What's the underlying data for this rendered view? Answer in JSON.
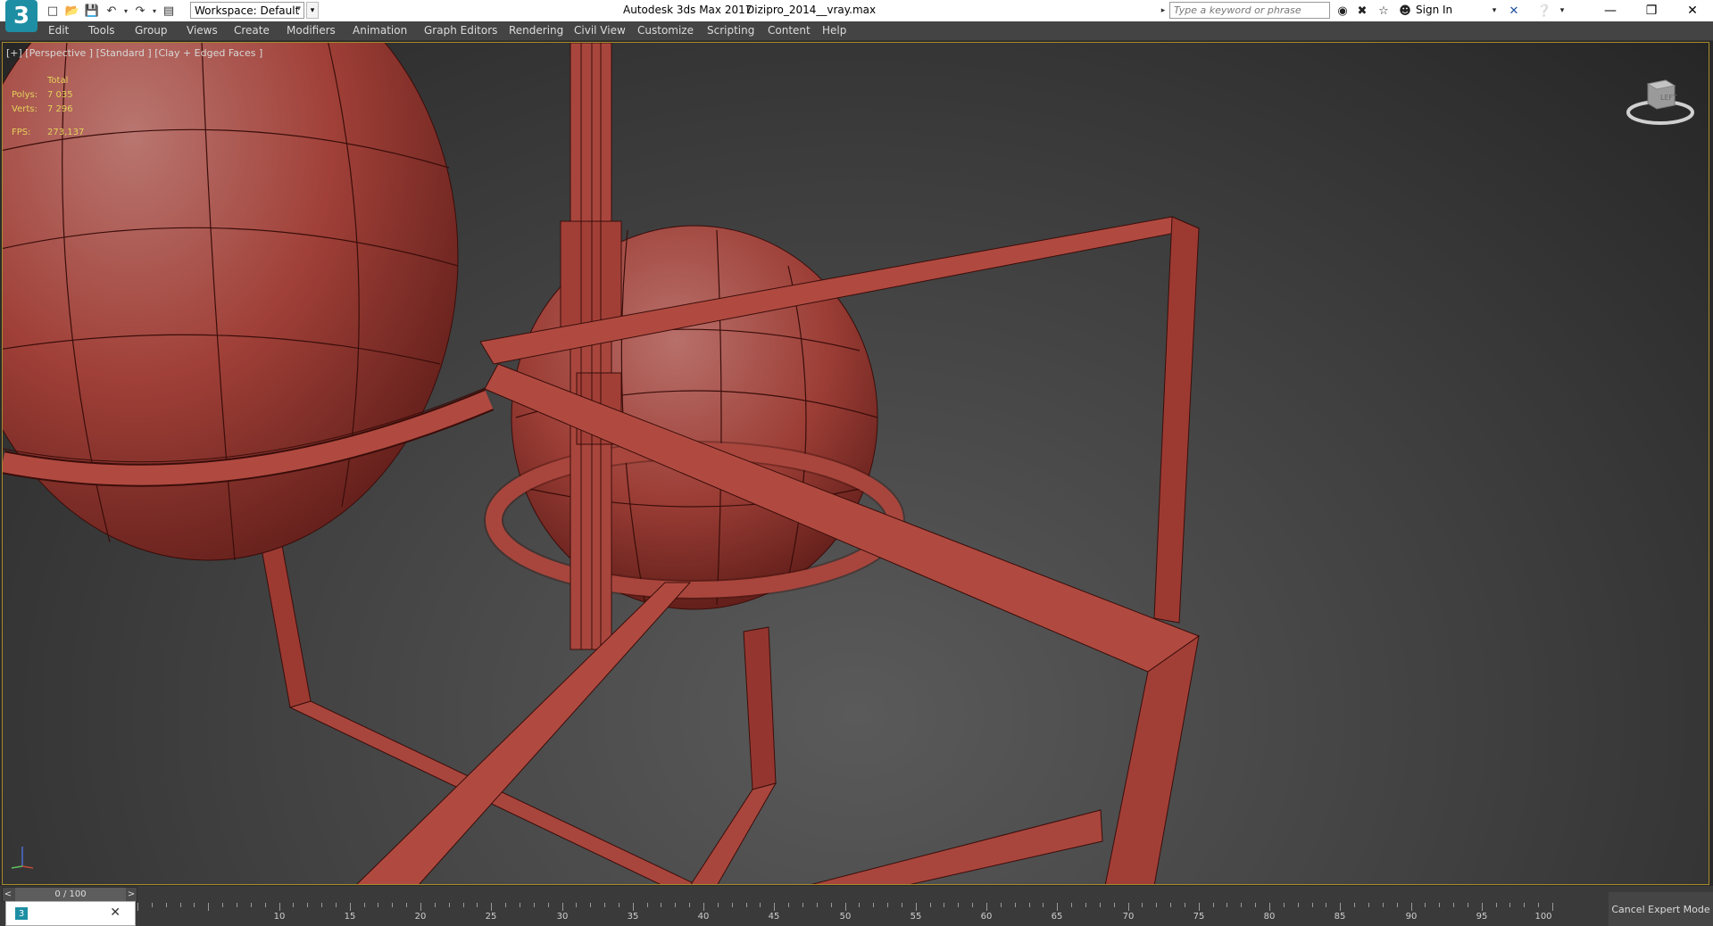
{
  "window": {
    "app_title": "Autodesk 3ds Max 2017",
    "document_name": "Dizipro_2014__vray.max",
    "logo_text": "3",
    "search_placeholder": "Type a keyword or phrase",
    "sign_in_label": "Sign In",
    "workspace_label": "Workspace: Default"
  },
  "menu": [
    "Edit",
    "Tools",
    "Group",
    "Views",
    "Create",
    "Modifiers",
    "Animation",
    "Graph Editors",
    "Rendering",
    "Civil View",
    "Customize",
    "Scripting",
    "Content",
    "Help"
  ],
  "viewport": {
    "label": "[+] [Perspective ] [Standard ] [Clay + Edged Faces ]",
    "stats": {
      "total_label": "Total",
      "polys_label": "Polys:",
      "polys_value": "7 035",
      "verts_label": "Verts:",
      "verts_value": "7 296",
      "fps_label": "FPS:",
      "fps_value": "273,137"
    },
    "viewcube_face": "LEFT",
    "model_color": "#b04a40",
    "selection_border": "#a68a2c"
  },
  "timeline": {
    "slider_text": "0 / 100",
    "tick_labels": [
      "10",
      "15",
      "20",
      "25",
      "30",
      "35",
      "40",
      "45",
      "50",
      "55",
      "60",
      "65",
      "70",
      "75",
      "80",
      "85",
      "90",
      "95",
      "100"
    ]
  },
  "status": {
    "cancel_expert_label": "Cancel Expert Mode"
  },
  "icons": {
    "new": "new-file-icon",
    "open": "open-file-icon",
    "save": "save-icon",
    "undo": "undo-icon",
    "redo": "redo-icon",
    "project": "project-folder-icon",
    "binoculars": "binoculars-icon",
    "tools": "tools-icon",
    "star": "star-icon",
    "user": "user-icon",
    "exchange": "exchange-icon",
    "help": "help-icon"
  }
}
